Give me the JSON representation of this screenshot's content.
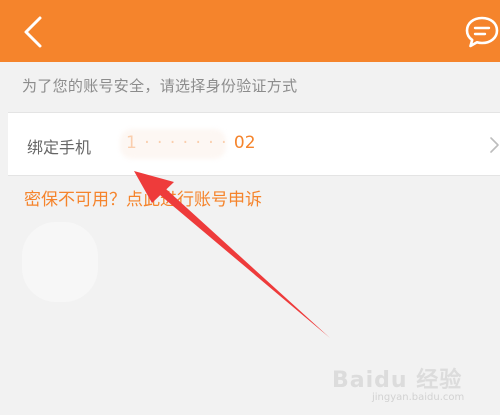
{
  "header": {
    "back_icon": "chevron-left-icon",
    "message_icon": "chat-bubble-icon",
    "color": "#f5842c"
  },
  "notice": {
    "text": "为了您的账号安全，请选择身份验证方式"
  },
  "verify_phone": {
    "label": "绑定手机",
    "value_visible": "02",
    "chevron_icon": "chevron-right-icon"
  },
  "appeal": {
    "text": "密保不可用？点此进行账号申诉"
  },
  "watermark": {
    "brand": "Baidu 经验",
    "url": "jingyan.baidu.com"
  },
  "colors": {
    "accent": "#f5842c",
    "background": "#f2f2f2",
    "annotation_arrow": "#ee3b3b"
  }
}
